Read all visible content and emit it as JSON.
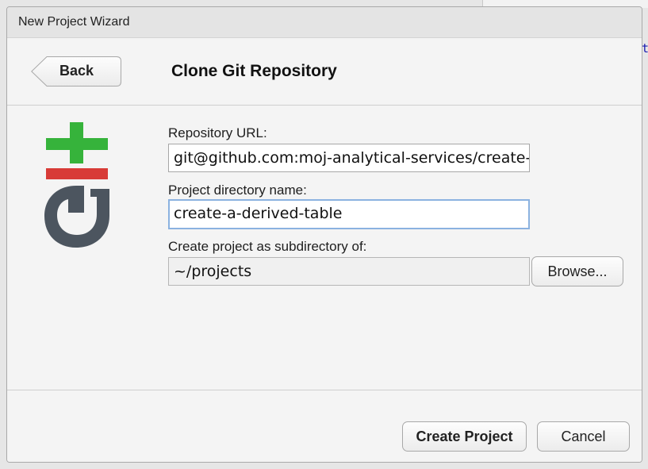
{
  "window": {
    "title": "New Project Wizard"
  },
  "backdrop": {
    "edge_glyph": "t"
  },
  "header": {
    "back_label": "Back",
    "title": "Clone Git Repository"
  },
  "logo": {
    "icon": "git-logo-icon",
    "colors": {
      "plus": "#36b33b",
      "minus": "#d83b37",
      "letter": "#4c555f"
    }
  },
  "form": {
    "repository_url": {
      "label": "Repository URL:",
      "value": "git@github.com:moj-analytical-services/create-a-derived-table.git"
    },
    "directory_name": {
      "label": "Project directory name:",
      "value": "create-a-derived-table"
    },
    "subdirectory": {
      "label": "Create project as subdirectory of:",
      "value": "~/projects",
      "browse_label": "Browse..."
    }
  },
  "footer": {
    "create_label": "Create Project",
    "cancel_label": "Cancel"
  },
  "colors": {
    "focus_ring": "#8bb2e0",
    "dialog_bg": "#f4f4f4"
  }
}
